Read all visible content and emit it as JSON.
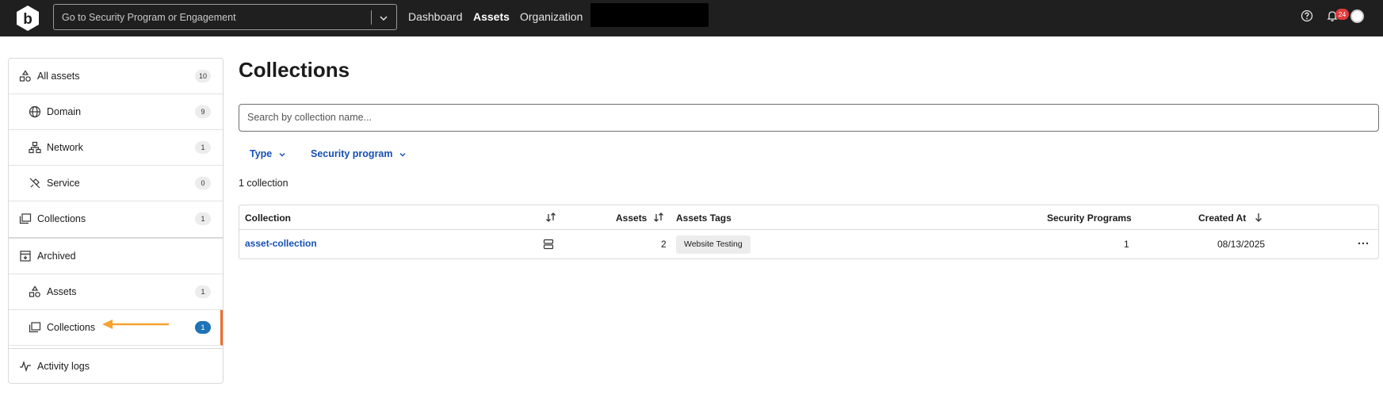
{
  "topbar": {
    "search_placeholder": "Go to Security Program or Engagement",
    "nav": [
      "Dashboard",
      "Assets",
      "Organization"
    ],
    "active_nav": "Assets",
    "notification_count": "24"
  },
  "sidebar": {
    "items": [
      {
        "label": "All assets",
        "count": "10",
        "icon": "assets-shapes-icon"
      },
      {
        "label": "Domain",
        "count": "9",
        "icon": "globe-icon"
      },
      {
        "label": "Network",
        "count": "1",
        "icon": "network-icon"
      },
      {
        "label": "Service",
        "count": "0",
        "icon": "plug-icon"
      },
      {
        "label": "Collections",
        "count": "1",
        "icon": "folders-icon"
      },
      {
        "label": "Archived",
        "count": "",
        "icon": "archive-box-icon"
      },
      {
        "label": "Assets",
        "count": "1",
        "icon": "assets-shapes-icon"
      },
      {
        "label": "Collections",
        "count": "1",
        "icon": "folders-icon"
      },
      {
        "label": "Activity logs",
        "count": "",
        "icon": "activity-icon"
      }
    ],
    "selected_index": 7,
    "accent_color": "#ef6c2b",
    "annotation_color": "#f5a230"
  },
  "main": {
    "title": "Collections",
    "search_placeholder": "Search by collection name...",
    "filters": [
      "Type",
      "Security program"
    ],
    "count_text": "1 collection",
    "table": {
      "headers": [
        "Collection",
        "Assets",
        "Assets Tags",
        "Security Programs",
        "Created At"
      ],
      "rows": [
        {
          "collection": "asset-collection",
          "assets": "2",
          "tag": "Website Testing",
          "security_programs": "1",
          "created_at": "08/13/2025"
        }
      ]
    }
  }
}
